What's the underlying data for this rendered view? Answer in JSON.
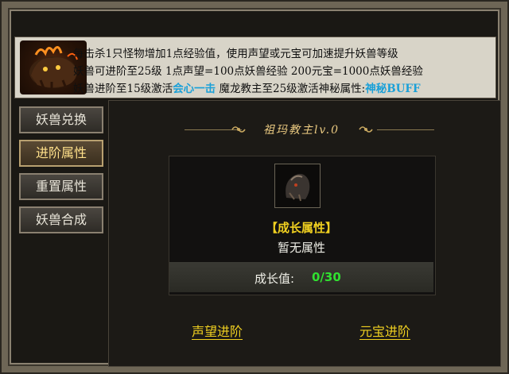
{
  "banner": {
    "line1": "每击杀1只怪物增加1点经验值，使用声望或元宝可加速提升妖兽等级",
    "line2": "妖兽可进阶至25级 1点声望=100点妖兽经验 200元宝=1000点妖兽经验",
    "line3_prefix": "妖兽进阶至15级激活",
    "line3_skill": "会心一击",
    "line3_mid": " 魔龙教主至25级激活神秘属性:",
    "line3_buff": "神秘BUFF"
  },
  "sidebar": {
    "items": [
      {
        "label": "妖兽兑换"
      },
      {
        "label": "进阶属性"
      },
      {
        "label": "重置属性"
      },
      {
        "label": "妖兽合成"
      }
    ],
    "active_index": 1
  },
  "panel": {
    "title": "祖玛教主lv.0",
    "growth_title": "【成长属性】",
    "no_attr": "暂无属性",
    "growth_label": "成长值:",
    "growth_value": "0/30"
  },
  "actions": {
    "reputation": "声望进阶",
    "ingot": "元宝进阶"
  },
  "colors": {
    "highlight_cyan": "#1aa0d8",
    "gold_text": "#f0d020",
    "green_value": "#30e030"
  }
}
